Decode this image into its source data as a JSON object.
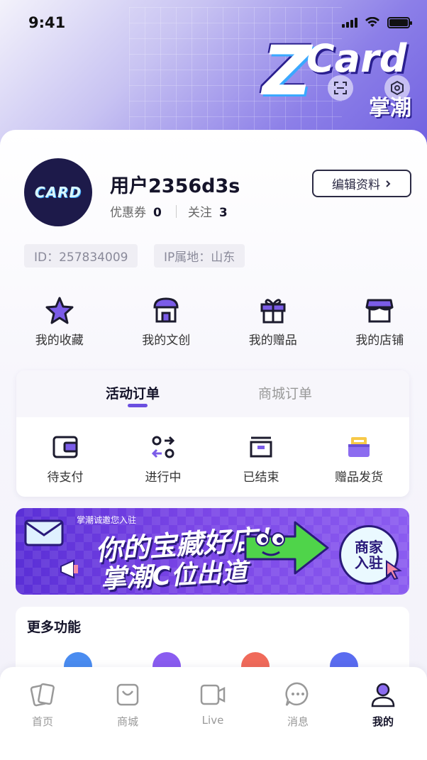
{
  "status_bar": {
    "time": "9:41"
  },
  "logo": {
    "brand": "ZCard",
    "cn": "掌潮"
  },
  "profile": {
    "avatar_text": "CARD",
    "username": "用户2356d3s",
    "coupons_label": "优惠券",
    "coupons_count": "0",
    "following_label": "关注",
    "following_count": "3",
    "edit_label": "编辑资料",
    "id_text": "ID：257834009",
    "ip_text": "IP属地：山东"
  },
  "quick_actions": [
    {
      "label": "我的收藏",
      "icon": "star-icon"
    },
    {
      "label": "我的文创",
      "icon": "shop-house-icon"
    },
    {
      "label": "我的赠品",
      "icon": "gift-icon"
    },
    {
      "label": "我的店铺",
      "icon": "store-icon"
    }
  ],
  "orders": {
    "tab_active": "活动订单",
    "tab_inactive": "商城订单",
    "items": [
      {
        "label": "待支付",
        "icon": "wallet-icon"
      },
      {
        "label": "进行中",
        "icon": "transfer-icon"
      },
      {
        "label": "已结束",
        "icon": "box-icon"
      },
      {
        "label": "赠品发货",
        "icon": "gift-box-icon"
      }
    ]
  },
  "banner": {
    "small": "掌潮诚邀您入驻",
    "line1": "你的宝藏好店！",
    "line2": "掌潮C位出道",
    "cta_line1": "商家",
    "cta_line2": "入驻"
  },
  "more": {
    "title": "更多功能"
  },
  "tabbar": [
    {
      "label": "首页",
      "icon": "cards-icon",
      "active": false
    },
    {
      "label": "商城",
      "icon": "bag-icon",
      "active": false
    },
    {
      "label": "Live",
      "icon": "live-icon",
      "active": false
    },
    {
      "label": "消息",
      "icon": "chat-icon",
      "active": false
    },
    {
      "label": "我的",
      "icon": "person-icon",
      "active": true
    }
  ],
  "colors": {
    "accent": "#6b4fe0",
    "dark": "#15142a",
    "banner": "#5a2fd6"
  }
}
